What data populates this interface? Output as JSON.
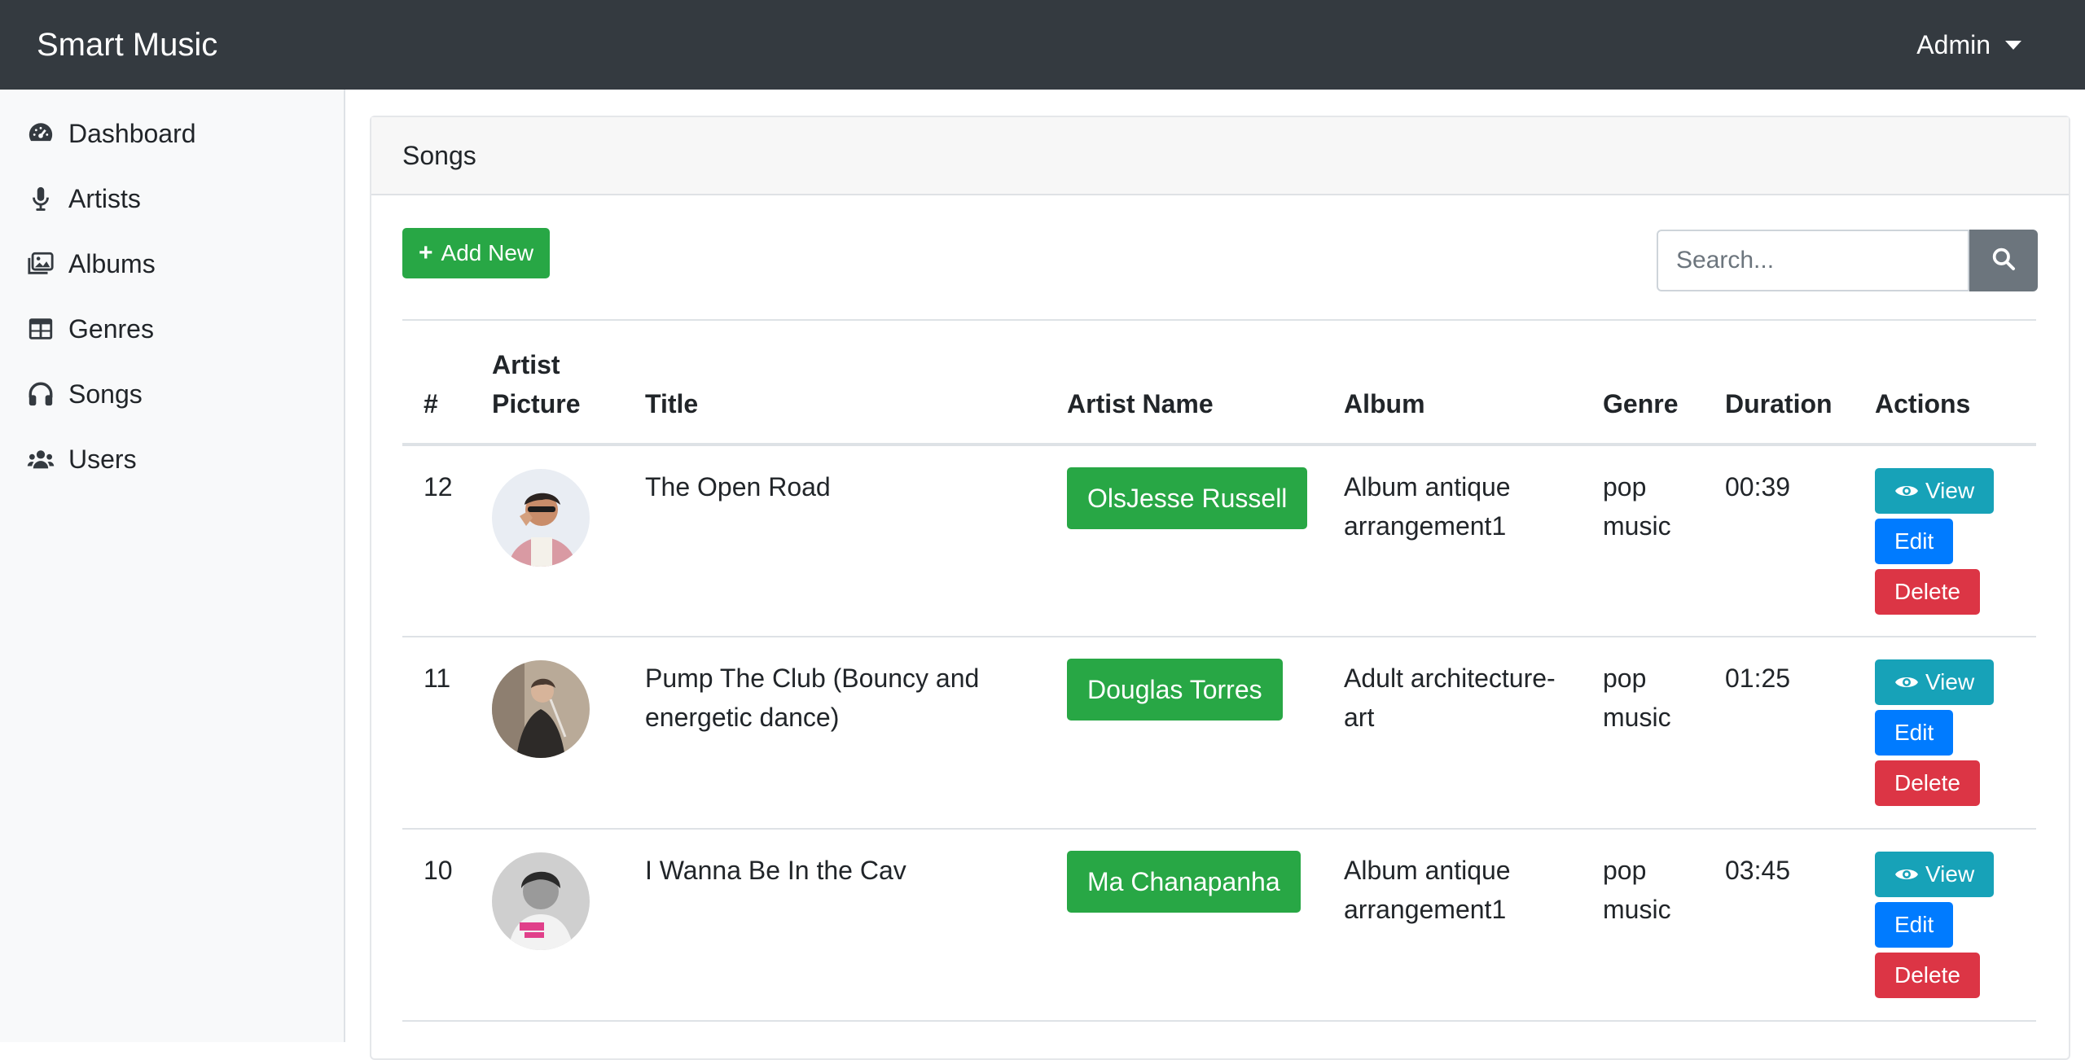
{
  "topbar": {
    "brand": "Smart Music",
    "user_menu": "Admin",
    "user_menu_icon": "caret-down-icon"
  },
  "sidebar": {
    "items": [
      {
        "label": "Dashboard",
        "icon": "tachometer-icon"
      },
      {
        "label": "Artists",
        "icon": "microphone-icon"
      },
      {
        "label": "Albums",
        "icon": "images-icon"
      },
      {
        "label": "Genres",
        "icon": "table-icon"
      },
      {
        "label": "Songs",
        "icon": "headphones-icon"
      },
      {
        "label": "Users",
        "icon": "users-icon"
      }
    ]
  },
  "card": {
    "title": "Songs",
    "add_button": "Add New",
    "search_placeholder": "Search...",
    "search_icon": "search-icon"
  },
  "table": {
    "headers": [
      "#",
      "Artist Picture",
      "Title",
      "Artist Name",
      "Album",
      "Genre",
      "Duration",
      "Actions"
    ],
    "rows": [
      {
        "id": "12",
        "title": "The Open Road",
        "artist": "OlsJesse Russell",
        "album": "Album antique arrangement1",
        "genre": "pop music",
        "duration": "00:39"
      },
      {
        "id": "11",
        "title": "Pump The Club (Bouncy and energetic dance)",
        "artist": "Douglas Torres",
        "album": "Adult architecture-art",
        "genre": "pop music",
        "duration": "01:25"
      },
      {
        "id": "10",
        "title": "I Wanna Be In the Cav",
        "artist": "Ma Chanapanha",
        "album": "Album antique arrangement1",
        "genre": "pop music",
        "duration": "03:45"
      }
    ],
    "actions": {
      "view": "View",
      "edit": "Edit",
      "delete": "Delete"
    }
  },
  "colors": {
    "topbar": "#343a40",
    "success": "#28a745",
    "info": "#17a2b8",
    "primary": "#007bff",
    "danger": "#dc3545",
    "secondary": "#6c757d"
  }
}
